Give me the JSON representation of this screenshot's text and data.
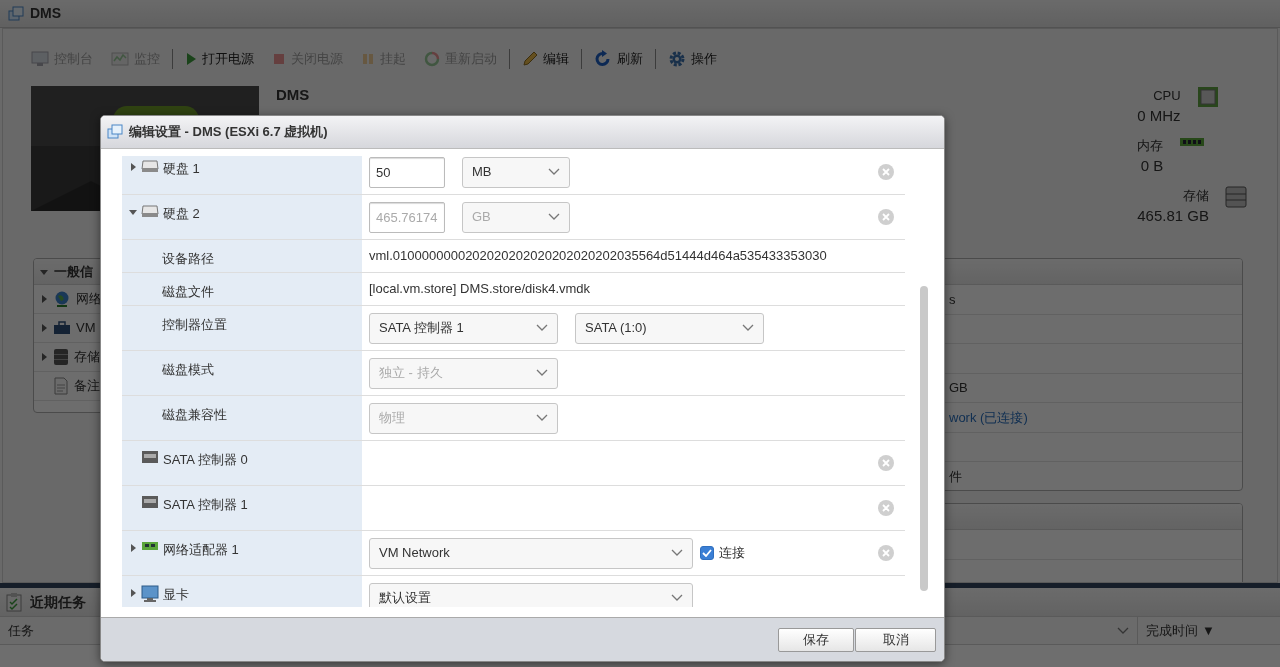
{
  "window": {
    "title": "DMS"
  },
  "toolbar": {
    "groups": [
      {
        "items": [
          {
            "kind": "console",
            "label": "控制台",
            "disabled": true
          },
          {
            "kind": "monitor",
            "label": "监控",
            "disabled": true
          }
        ]
      },
      {
        "items": [
          {
            "kind": "power_on",
            "label": "打开电源",
            "disabled": false
          },
          {
            "kind": "power_off",
            "label": "关闭电源",
            "disabled": true
          },
          {
            "kind": "suspend",
            "label": "挂起",
            "disabled": true
          },
          {
            "kind": "restart",
            "label": "重新启动",
            "disabled": true
          }
        ]
      },
      {
        "items": [
          {
            "kind": "edit",
            "label": "编辑",
            "disabled": false
          }
        ]
      },
      {
        "items": [
          {
            "kind": "refresh",
            "label": "刷新",
            "disabled": false
          }
        ]
      },
      {
        "items": [
          {
            "kind": "actions",
            "label": "操作",
            "disabled": false
          }
        ]
      }
    ]
  },
  "vm": {
    "name": "DMS"
  },
  "resources": [
    {
      "kind": "cpu",
      "label": "CPU",
      "value": "0 MHz"
    },
    {
      "kind": "memory",
      "label": "内存",
      "value": "0 B"
    },
    {
      "kind": "storage",
      "label": "存储",
      "value": "465.81 GB"
    }
  ],
  "general_info": {
    "title": "一般信",
    "expanded": true,
    "rows": [
      {
        "kind": "network",
        "label": "网络",
        "expanded": false
      },
      {
        "kind": "tools",
        "label": "VM",
        "expanded": false
      },
      {
        "kind": "storage",
        "label": "存储",
        "expanded": false
      },
      {
        "kind": "notes",
        "label": "备注"
      }
    ]
  },
  "details_panel": {
    "rows": [
      {
        "value": "s"
      },
      {},
      {},
      {
        "value": "GB"
      },
      {
        "value": "work (已连接)",
        "kind": "link"
      },
      {},
      {
        "value": "件"
      }
    ]
  },
  "recent_tasks": {
    "title": "近期任务",
    "columns": [
      {
        "label": "任务"
      },
      {
        "label": "完成时间",
        "sort": "▼"
      }
    ]
  },
  "dialog": {
    "title": "编辑设置 - DMS (ESXi 6.7 虚拟机)",
    "rows": [
      {
        "kind": "disk",
        "label": "硬盘 1",
        "expanded": false,
        "removable": true,
        "controls": [
          {
            "kind": "input",
            "value": "50",
            "disabled": false
          },
          {
            "kind": "select",
            "value": "MB",
            "disabled": false
          }
        ]
      },
      {
        "kind": "disk",
        "label": "硬盘 2",
        "expanded": true,
        "removable": true,
        "controls": [
          {
            "kind": "input",
            "value": "465.76174",
            "disabled": true
          },
          {
            "kind": "select",
            "value": "GB",
            "disabled": true
          }
        ]
      },
      {
        "kind": "property",
        "label": "设备路径",
        "text": "vml.0100000000202020202020202020202035564d51444d464a535433353030"
      },
      {
        "kind": "property",
        "label": "磁盘文件",
        "text": "[local.vm.store] DMS.store/disk4.vmdk"
      },
      {
        "kind": "property",
        "label": "控制器位置",
        "controls": [
          {
            "kind": "select",
            "value": "SATA 控制器 1",
            "disabled": false
          },
          {
            "kind": "select",
            "value": "SATA (1:0)",
            "disabled": false
          }
        ]
      },
      {
        "kind": "property",
        "label": "磁盘模式",
        "controls": [
          {
            "kind": "select",
            "value": "独立 - 持久",
            "disabled": true
          }
        ]
      },
      {
        "kind": "property",
        "label": "磁盘兼容性",
        "controls": [
          {
            "kind": "select",
            "value": "物理",
            "disabled": true
          }
        ]
      },
      {
        "kind": "sata",
        "label": "SATA 控制器 0",
        "removable": true
      },
      {
        "kind": "sata",
        "label": "SATA 控制器 1",
        "removable": true
      },
      {
        "kind": "nic",
        "label": "网络适配器 1",
        "expanded": false,
        "removable": true,
        "controls": [
          {
            "kind": "select",
            "value": "VM Network",
            "disabled": false
          },
          {
            "kind": "checkbox",
            "label": "连接",
            "checked": true
          }
        ]
      },
      {
        "kind": "display",
        "label": "显卡",
        "expanded": false,
        "controls": [
          {
            "kind": "select",
            "value": "默认设置",
            "disabled": false
          }
        ]
      }
    ],
    "buttons": [
      {
        "label": "保存"
      },
      {
        "label": "取消"
      }
    ]
  }
}
